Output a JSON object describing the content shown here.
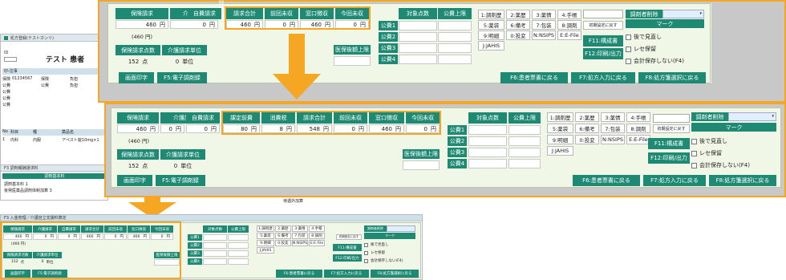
{
  "accent_color": "#1e8a74",
  "highlight_color": "#f5a623",
  "panel_bg_color": "#f1f7e6",
  "bg_window": {
    "title": "処方登録(テストカンリ)",
    "id_label": "ID",
    "patient_name": "テスト 患者",
    "section_label": "印-注事",
    "insurance_number": "01234567",
    "row_labels": [
      "保険",
      "公費",
      "公費",
      "公費",
      "公費"
    ],
    "field_labels": [
      "保険",
      "公費",
      "負担",
      "負担"
    ],
    "table_headers": [
      "No",
      "科目",
      "種",
      "薬品名"
    ],
    "table_row": {
      "no": "1",
      "dept": "内科",
      "type": "内服",
      "drug": "アペスト錠10mg×1"
    }
  },
  "bg_window2": {
    "title": "F3 調剤報酬請求料",
    "header": "調剤基本料",
    "lines": [
      "調剤基本料 1",
      "後発医薬品調剤体制加算 3"
    ],
    "extra_label": "待遇外加算"
  },
  "summary_a": {
    "cols": [
      "保険請求",
      "介護請求",
      "自費請求",
      "請求合計",
      "前回未収",
      "窓口徴収",
      "今回未収"
    ],
    "values": [
      "460",
      "0",
      "0",
      "460",
      "0",
      "460",
      "0"
    ],
    "unit_yen": "円",
    "sub_value": "(460 円)",
    "points_label": "保険請求点数",
    "points_value": "152",
    "points_unit": "点",
    "units_label": "介護請求単位",
    "units_value": "0",
    "units_unit": "単位"
  },
  "summary_b": {
    "cols": [
      "保険請求",
      "介護請求",
      "自費請求",
      "課定前費",
      "消費税",
      "請求合計",
      "前回未収",
      "窓口徴収",
      "今回未収"
    ],
    "values": [
      "460",
      "0",
      "0",
      "80",
      "8",
      "548",
      "0",
      "460",
      "0"
    ],
    "unit_yen": "円",
    "sub_value": "(460 円)",
    "points_label": "保険請求点数",
    "points_value": "152",
    "points_unit": "点",
    "units_label": "介護請求単位",
    "units_value": "0",
    "units_unit": "単位"
  },
  "public": {
    "col_count": "対象点数",
    "col_upper": "公費上限",
    "rows": [
      "公費1",
      "公費2",
      "公費3",
      "公費4"
    ],
    "medical_upper": "医保後額上限"
  },
  "grid": {
    "buttons": [
      "1:調剤歴",
      "2:薬歴",
      "3:薬情",
      "4:手帳",
      "5:薬袋",
      "6:備考",
      "7:包装",
      "8:調剤",
      "9:明細",
      "0:投変",
      "N:NSIPS",
      "E:E-File"
    ],
    "jahis": "J:JAHIS",
    "initial_setting": "初期設定に戻す"
  },
  "side": {
    "pharmacist_label": "調剤者削除",
    "mark_label": "マーク",
    "f11": "F11:構成書",
    "f12": "F12:印刷/出力",
    "check_later": "後で見直し",
    "check_rece": "レセ保留",
    "check_nosave": "会計保存しない(F4)"
  },
  "footer": {
    "print": "画面印字",
    "f5": "F5:電子調剤録",
    "f6": "F6:患者票書に戻る",
    "f7": "F7:処方入力に戻る",
    "f8": "F8:処方箋選択に戻る"
  },
  "bottom_window": {
    "title": "F3 入金管理／介護自立支援料算定"
  }
}
